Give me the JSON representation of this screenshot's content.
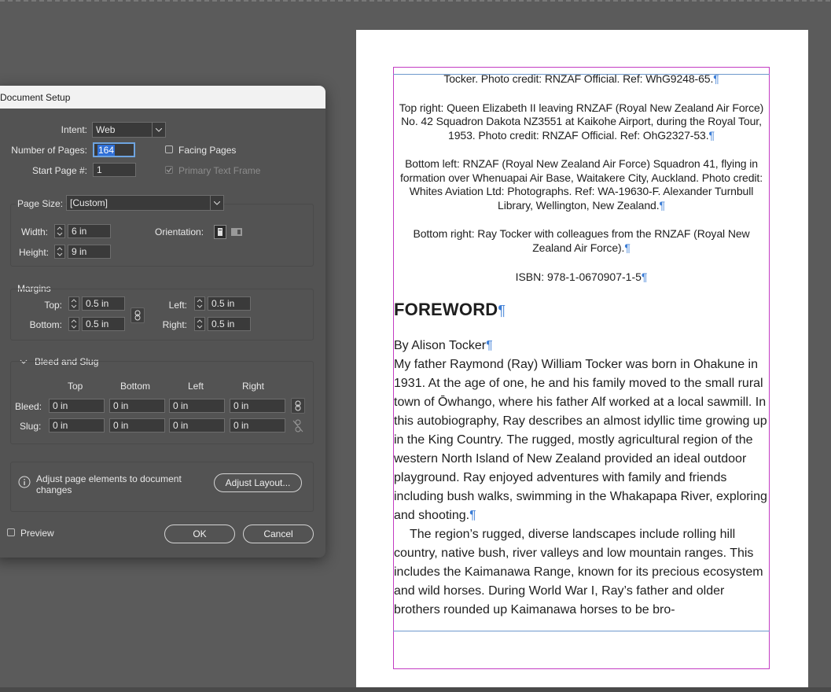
{
  "dialog": {
    "title": "Document Setup",
    "intent_label": "Intent:",
    "intent_value": "Web",
    "num_pages_label": "Number of Pages:",
    "num_pages_value": "164",
    "start_page_label": "Start Page #:",
    "start_page_value": "1",
    "facing_pages_label": "Facing Pages",
    "primary_text_frame_label": "Primary Text Frame",
    "page_size_label": "Page Size:",
    "page_size_value": "[Custom]",
    "width_label": "Width:",
    "width_value": "6 in",
    "height_label": "Height:",
    "height_value": "9 in",
    "orientation_label": "Orientation:",
    "margins_label": "Margins",
    "margins": {
      "top_label": "Top:",
      "top_value": "0.5 in",
      "bottom_label": "Bottom:",
      "bottom_value": "0.5 in",
      "left_label": "Left:",
      "left_value": "0.5 in",
      "right_label": "Right:",
      "right_value": "0.5 in"
    },
    "bleed_slug_label": "Bleed and Slug",
    "bleed_slug": {
      "col_top": "Top",
      "col_bottom": "Bottom",
      "col_left": "Left",
      "col_right": "Right",
      "bleed_label": "Bleed:",
      "bleed": [
        "0 in",
        "0 in",
        "0 in",
        "0 in"
      ],
      "slug_label": "Slug:",
      "slug": [
        "0 in",
        "0 in",
        "0 in",
        "0 in"
      ]
    },
    "info_text": "Adjust page elements to document changes",
    "adjust_layout_label": "Adjust Layout...",
    "preview_label": "Preview",
    "ok_label": "OK",
    "cancel_label": "Cancel"
  },
  "document": {
    "captions": [
      "Tocker. Photo credit: RNZAF Official. Ref: WhG9248-65.",
      "Top right: Queen Elizabeth II leaving RNZAF (Royal New Zealand Air Force) No. 42 Squadron Dakota NZ3551 at Kaikohe Airport, during the Royal Tour, 1953. Photo credit: RNZAF Official. Ref: OhG2327-53.",
      "Bottom left: RNZAF (Royal New Zealand Air Force) Squadron 41, flying in formation over Whenuapai Air Base, Waitakere City, Auckland. Photo credit: Whites Aviation Ltd: Photographs. Ref: WA-19630-F. Alexander Turnbull Library, Wellington, New Zealand.",
      "Bottom right: Ray Tocker with colleagues from the RNZAF (Royal New Zealand Air Force)."
    ],
    "isbn": "ISBN: 978-1-0670907-1-5",
    "heading": "FOREWORD",
    "byline": "By Alison Tocker",
    "para1": "My father Raymond (Ray) William Tocker was born in Ohakune in 1931. At the age of one, he and his family moved to the small rural town of Ōwhango, where his father Alf worked at a local sawmill. In this autobiography, Ray describes an almost idyllic time growing up in the King Country. The rugged, mostly agricultural region of the western North Island of New Zealand provided an ideal outdoor playground. Ray enjoyed adventures with family and friends including bush walks, swimming in the Whakapapa River, exploring and shooting.",
    "para2": "The region’s rugged, diverse landscapes include rolling hill country, native bush, river valleys and low mountain ranges. This includes the Kaimanawa Range, known for its precious ecosystem and wild horses. During World War I, Ray’s father and older brothers rounded up Kaimanawa horses to be bro-",
    "pilcrow": "¶"
  }
}
